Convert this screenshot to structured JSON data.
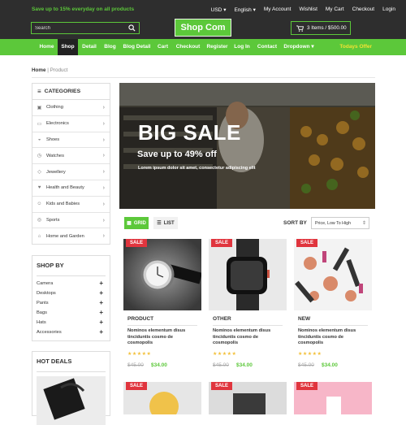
{
  "topbar": {
    "promo": "Save up to 15% everyday on all products",
    "currency": "USD",
    "language": "English",
    "links": [
      "My Account",
      "Wishlist",
      "My Cart",
      "Checkout",
      "Login"
    ]
  },
  "header": {
    "search_placeholder": "Search",
    "logo": "Shop Com",
    "cart_summary": "3 Items / $500.00"
  },
  "nav": {
    "items": [
      "Home",
      "Shop",
      "Detail",
      "Blog",
      "Blog Detail",
      "Cart",
      "Checkout",
      "Register",
      "Log In",
      "Contact",
      "Dropdown"
    ],
    "active": "Shop",
    "right": "Todays Offer"
  },
  "breadcrumb": {
    "home": "Home",
    "current": "Product"
  },
  "categories": {
    "title": "CATEGORIES",
    "items": [
      "Clothing",
      "Electronics",
      "Shoes",
      "Watches",
      "Jewellery",
      "Health and Beauty",
      "Kids and Babies",
      "Sports",
      "Home and Garden"
    ]
  },
  "shopby": {
    "title": "SHOP BY",
    "items": [
      "Camera",
      "Desktops",
      "Pants",
      "Bags",
      "Hats",
      "Accessories"
    ]
  },
  "hotdeals": {
    "title": "HOT DEALS"
  },
  "banner": {
    "title": "BIG SALE",
    "subtitle": "Save up to 49% off",
    "text": "Lorem ipsum dolor sit amet, consectetur adipiscing elit"
  },
  "toolbar": {
    "grid": "GRID",
    "list": "LIST",
    "sort_label": "SORT BY",
    "sort_value": "Price, Low To High"
  },
  "products": [
    {
      "badge": "SALE",
      "category": "PRODUCT",
      "title": "Nominos elementum disus tinciduntis cosmo de cosmopolis",
      "stars": "★★★★★",
      "old_price": "$45.00",
      "price": "$34.00"
    },
    {
      "badge": "SALE",
      "category": "OTHER",
      "title": "Nominos elementum disus tinciduntis cosmo de cosmopolis",
      "stars": "★★★★★",
      "old_price": "$45.00",
      "price": "$34.00"
    },
    {
      "badge": "SALE",
      "category": "NEW",
      "title": "Nominos elementum disus tinciduntis cosmo de cosmopolis",
      "stars": "★★★★★",
      "old_price": "$45.00",
      "price": "$34.00"
    }
  ],
  "more_products": [
    {
      "badge": "SALE"
    },
    {
      "badge": "SALE"
    },
    {
      "badge": "SALE"
    }
  ],
  "colors": {
    "accent": "#5cc83a",
    "dark": "#2e2e2e",
    "sale": "#e0353e",
    "offer": "#f2e233"
  }
}
